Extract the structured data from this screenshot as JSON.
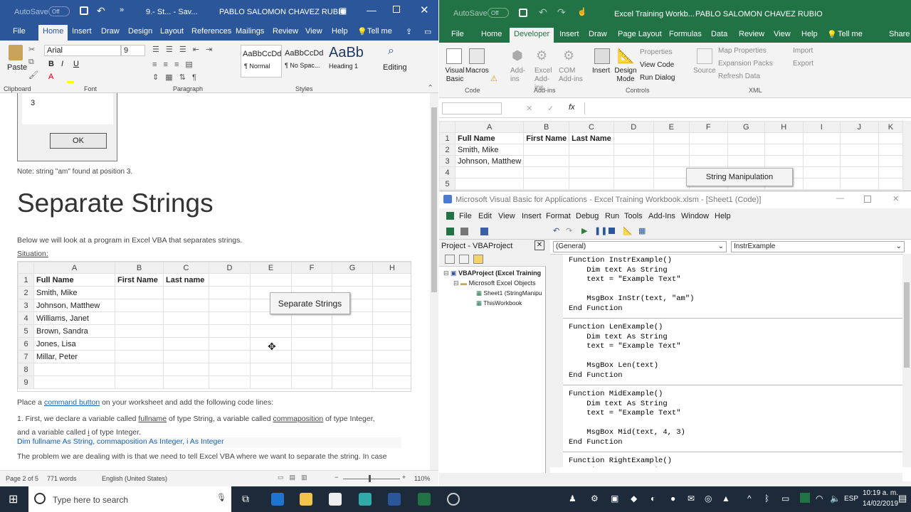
{
  "word": {
    "autosave": "AutoSave",
    "autosave_state": "Off",
    "title": "9.- St... - Sav...",
    "user": "PABLO SALOMON CHAVEZ RUBIO",
    "tabs": [
      "File",
      "Home",
      "Insert",
      "Draw",
      "Design",
      "Layout",
      "References",
      "Mailings",
      "Review",
      "View",
      "Help"
    ],
    "tell_me": "Tell me",
    "font_name": "Arial",
    "font_size": "9",
    "paste": "Paste",
    "clipboard": "Clipboard",
    "font_group": "Font",
    "paragraph_group": "Paragraph",
    "styles_group": "Styles",
    "styles": [
      {
        "preview": "AaBbCcDd",
        "name": "¶ Normal"
      },
      {
        "preview": "AaBbCcDd",
        "name": "¶ No Spac..."
      },
      {
        "preview": "AaBb",
        "name": "Heading 1"
      }
    ],
    "editing": "Editing",
    "msgbox_value": "3",
    "ok": "OK",
    "note": "Note: string \"am\" found at position 3.",
    "heading": "Separate Strings",
    "intro": "Below we will look at a program in Excel VBA that separates strings.",
    "situation": "Situation:",
    "sheet_cols": [
      "A",
      "B",
      "C",
      "D",
      "E",
      "F",
      "G",
      "H"
    ],
    "sheet_rows": [
      [
        "1",
        "Full Name",
        "First Name",
        "Last name"
      ],
      [
        "2",
        "Smith, Mike",
        "",
        ""
      ],
      [
        "3",
        "Johnson, Matthew",
        "",
        ""
      ],
      [
        "4",
        "Williams, Janet",
        "",
        ""
      ],
      [
        "5",
        "Brown, Sandra",
        "",
        ""
      ],
      [
        "6",
        "Jones, Lisa",
        "",
        ""
      ],
      [
        "7",
        "Millar, Peter",
        "",
        ""
      ],
      [
        "8",
        "",
        "",
        ""
      ],
      [
        "9",
        "",
        "",
        ""
      ]
    ],
    "sheet_button": "Separate Strings",
    "place_pre": "Place a ",
    "place_link": "command button",
    "place_post": " on your worksheet and add the following code lines:",
    "step1_a": "1. First, we declare a variable called ",
    "step1_b": "fullname",
    "step1_c": " of type String, a variable called ",
    "step1_d": "commaposition",
    "step1_e": " of type Integer,",
    "step1_f": "and a variable called ",
    "step1_g": "i",
    "step1_h": " of type Integer.",
    "code_line": "Dim fullname As String, commaposition As Integer, i As Integer",
    "cut_line": "The problem we are dealing with is that we need to tell Excel VBA where we want to separate the string. In case",
    "status_page": "Page 2 of 5",
    "status_words": "771 words",
    "status_lang": "English (United States)",
    "zoom": "110%"
  },
  "excel": {
    "autosave": "AutoSave",
    "autosave_state": "Off",
    "title": "Excel Training Workb...",
    "user": "PABLO SALOMON CHAVEZ RUBIO",
    "tabs": [
      "File",
      "Home",
      "Developer",
      "Insert",
      "Draw",
      "Page Layout",
      "Formulas",
      "Data",
      "Review",
      "View",
      "Help"
    ],
    "tell_me": "Tell me",
    "share": "Share",
    "code_group": "Code",
    "addins_group": "Add-ins",
    "controls_group": "Controls",
    "xml_group": "XML",
    "visual_basic": "Visual Basic",
    "macros": "Macros",
    "addins": "Add-ins",
    "excel_addins": "Excel Add-ins",
    "com_addins": "COM Add-ins",
    "insert": "Insert",
    "design_mode": "Design Mode",
    "properties": "Properties",
    "view_code": "View Code",
    "run_dialog": "Run Dialog",
    "source": "Source",
    "map_properties": "Map Properties",
    "expansion_packs": "Expansion Packs",
    "refresh_data": "Refresh Data",
    "import": "Import",
    "export": "Export",
    "fx": "fx",
    "cols": [
      "A",
      "B",
      "C",
      "D",
      "E",
      "F",
      "G",
      "H",
      "I",
      "J",
      "K"
    ],
    "rows": [
      [
        "1",
        "Full Name",
        "First Name",
        "Last Name"
      ],
      [
        "2",
        "Smith, Mike",
        "",
        ""
      ],
      [
        "3",
        "Johnson, Matthew",
        "",
        ""
      ],
      [
        "4",
        "",
        "",
        ""
      ],
      [
        "5",
        "",
        "",
        ""
      ]
    ],
    "button": "String Manipulation"
  },
  "vba": {
    "title": "Microsoft Visual Basic for Applications - Excel Training Workbook.xlsm - [Sheet1 (Code)]",
    "menu": [
      "File",
      "Edit",
      "View",
      "Insert",
      "Format",
      "Debug",
      "Run",
      "Tools",
      "Add-Ins",
      "Window",
      "Help"
    ],
    "project_title": "Project - VBAProject",
    "tree_root": "VBAProject (Excel Training",
    "tree_folder": "Microsoft Excel Objects",
    "tree_sheet": "Sheet1 (StringManipu",
    "tree_wb": "ThisWorkbook",
    "object_dd": "(General)",
    "proc_dd": "InstrExample",
    "code_blocks": [
      [
        "Function InstrExample()",
        "    Dim text As String",
        "    text = \"Example Text\"",
        "",
        "    MsgBox InStr(text, \"am\")",
        "End Function"
      ],
      [
        "Function LenExample()",
        "    Dim text As String",
        "    text = \"Example Text\"",
        "",
        "    MsgBox Len(text)",
        "End Function"
      ],
      [
        "Function MidExample()",
        "    Dim text As String",
        "    text = \"Example Text\"",
        "",
        "    MsgBox Mid(text, 4, 3)",
        "End Function"
      ],
      [
        "Function RightExample()",
        "    Dim text As String"
      ]
    ]
  },
  "taskbar": {
    "search_placeholder": "Type here to search",
    "lang": "ESP",
    "time": "10:19 a. m.",
    "date": "14/02/2019"
  }
}
